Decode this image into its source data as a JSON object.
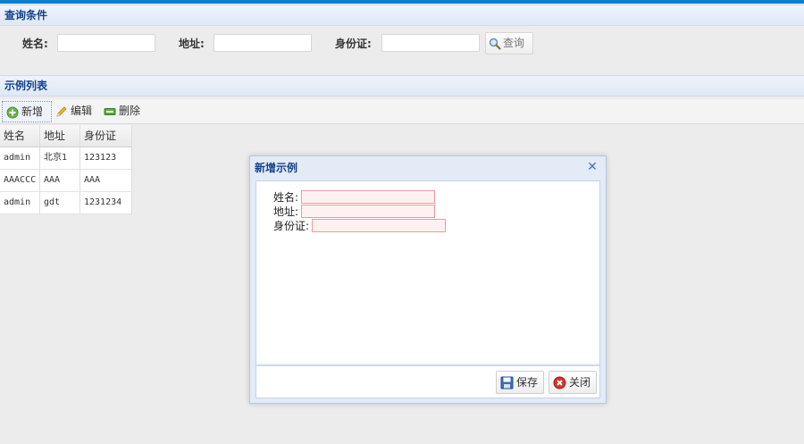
{
  "query_panel": {
    "title": "查询条件",
    "name_label": "姓名:",
    "address_label": "地址:",
    "id_label": "身份证:",
    "name_value": "",
    "address_value": "",
    "id_value": "",
    "search_label": "查询"
  },
  "list_panel": {
    "title": "示例列表",
    "toolbar": {
      "add_label": "新增",
      "edit_label": "编辑",
      "delete_label": "删除"
    },
    "columns": [
      "姓名",
      "地址",
      "身份证"
    ],
    "rows": [
      [
        "admin",
        "北京1",
        "123123"
      ],
      [
        "AAACCC",
        "AAA",
        "AAA"
      ],
      [
        "admin",
        "gdt",
        "1231234"
      ]
    ]
  },
  "dialog": {
    "title": "新增示例",
    "name_label": "姓名:",
    "address_label": "地址:",
    "id_label": "身份证:",
    "name_value": "",
    "address_value": "",
    "id_value": "",
    "save_label": "保存",
    "close_label": "关闭"
  },
  "icons": {
    "search": "magnifier-icon",
    "add": "add-circle-icon",
    "edit": "pencil-icon",
    "delete": "remove-bar-icon",
    "save": "floppy-disk-icon",
    "close": "red-x-circle-icon",
    "dialog_close": "close-x-icon"
  },
  "colors": {
    "accent": "#0b80c9",
    "panel_title": "#15428b",
    "invalid_border": "#f09a9a"
  }
}
